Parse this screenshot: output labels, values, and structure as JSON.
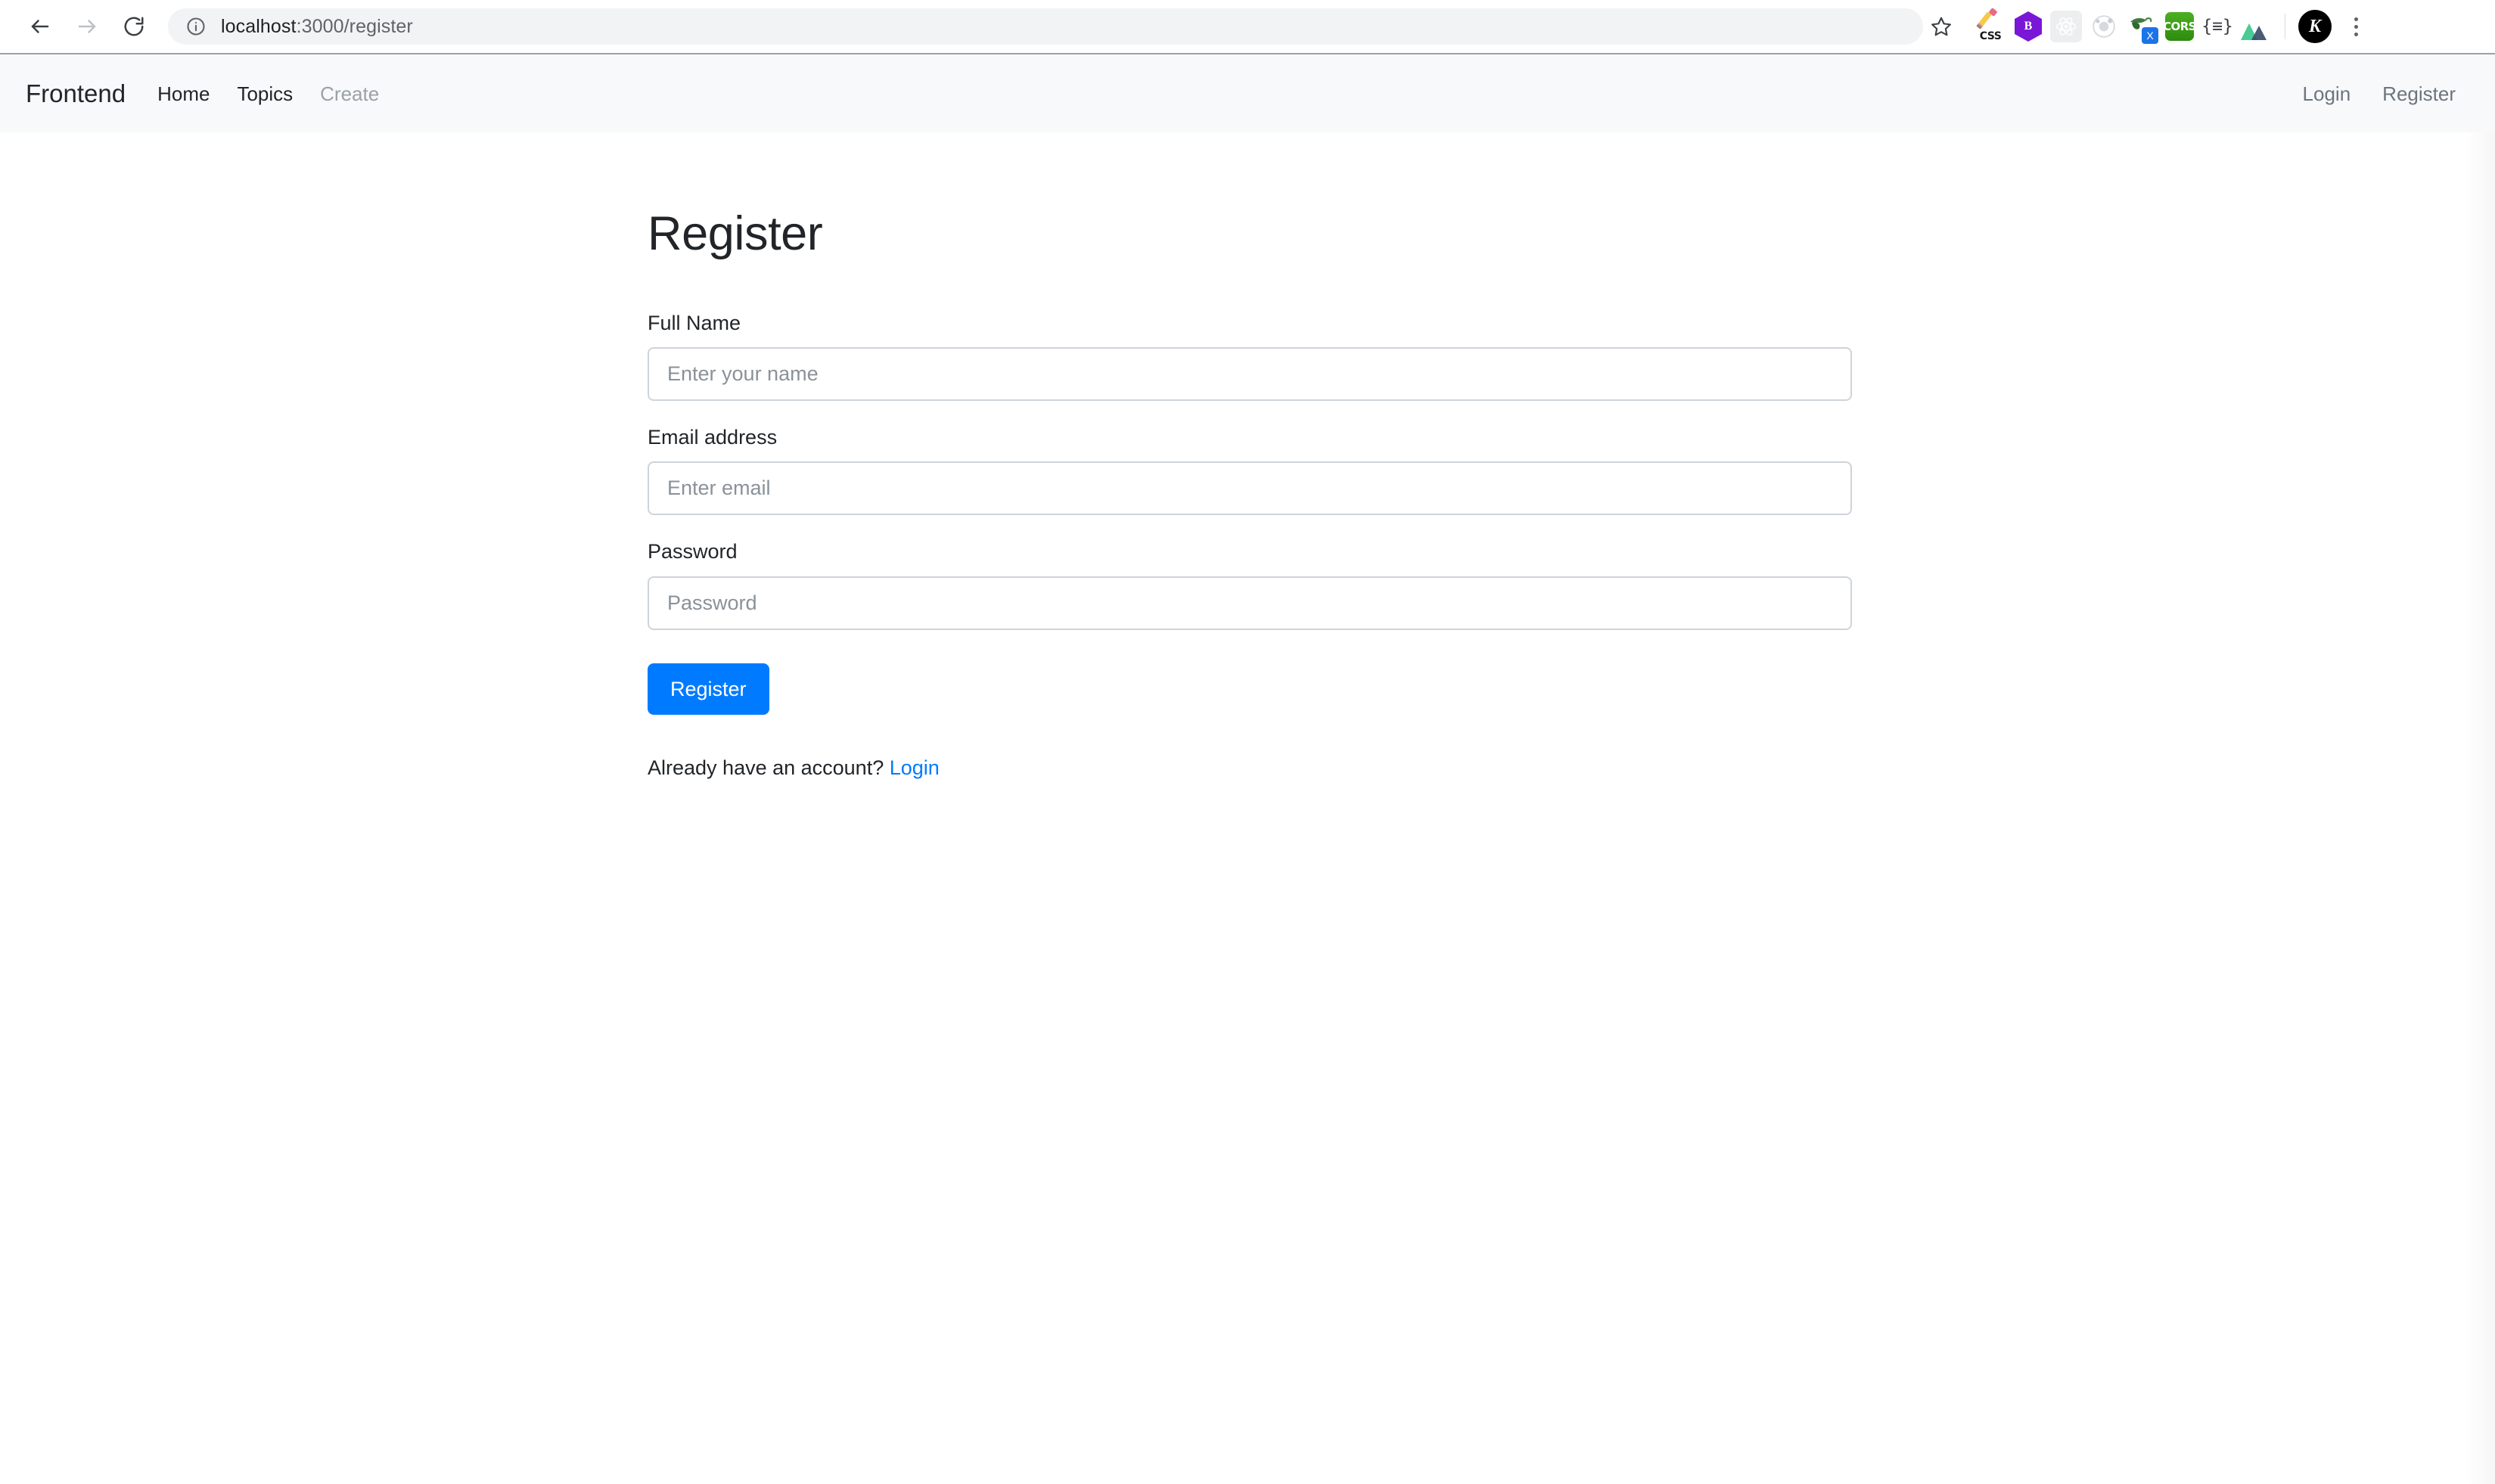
{
  "browser": {
    "back_label": "Back",
    "forward_label": "Forward",
    "reload_label": "Reload",
    "site_info_label": "View site information",
    "url_host": "localhost",
    "url_rest": ":3000/register",
    "bookmark_label": "Bookmark this tab",
    "menu_label": "Customize and control Chrome",
    "extensions": [
      {
        "name": "css-editor-icon",
        "label": "CSS"
      },
      {
        "name": "bootstrap-icon",
        "label": "B"
      },
      {
        "name": "react-devtools-icon",
        "label": "React"
      },
      {
        "name": "redux-devtools-icon",
        "label": "Redux"
      },
      {
        "name": "xpath-helper-icon",
        "label": "X"
      },
      {
        "name": "cors-unblock-icon",
        "label": "CORS"
      },
      {
        "name": "json-formatter-icon",
        "label": "{≡}"
      },
      {
        "name": "nuxt-devtools-icon",
        "label": "Nuxt"
      }
    ],
    "profile_initial": "K"
  },
  "navbar": {
    "brand": "Frontend",
    "links": [
      {
        "label": "Home",
        "muted": false
      },
      {
        "label": "Topics",
        "muted": false
      },
      {
        "label": "Create",
        "muted": true
      }
    ],
    "right_links": [
      {
        "label": "Login"
      },
      {
        "label": "Register"
      }
    ]
  },
  "main": {
    "title": "Register",
    "fields": [
      {
        "label": "Full Name",
        "placeholder": "Enter your name",
        "value": "",
        "type": "text",
        "name": "full-name"
      },
      {
        "label": "Email address",
        "placeholder": "Enter email",
        "value": "",
        "type": "email",
        "name": "email"
      },
      {
        "label": "Password",
        "placeholder": "Password",
        "value": "",
        "type": "password",
        "name": "password"
      }
    ],
    "submit_label": "Register",
    "account_note_text": "Already have an account?",
    "account_note_link": "Login"
  },
  "colors": {
    "primary": "#007bff",
    "link": "#007bff",
    "navbar_bg": "#f8f9fa",
    "text": "#212529",
    "muted": "#6c757d",
    "border": "#ced4da"
  }
}
